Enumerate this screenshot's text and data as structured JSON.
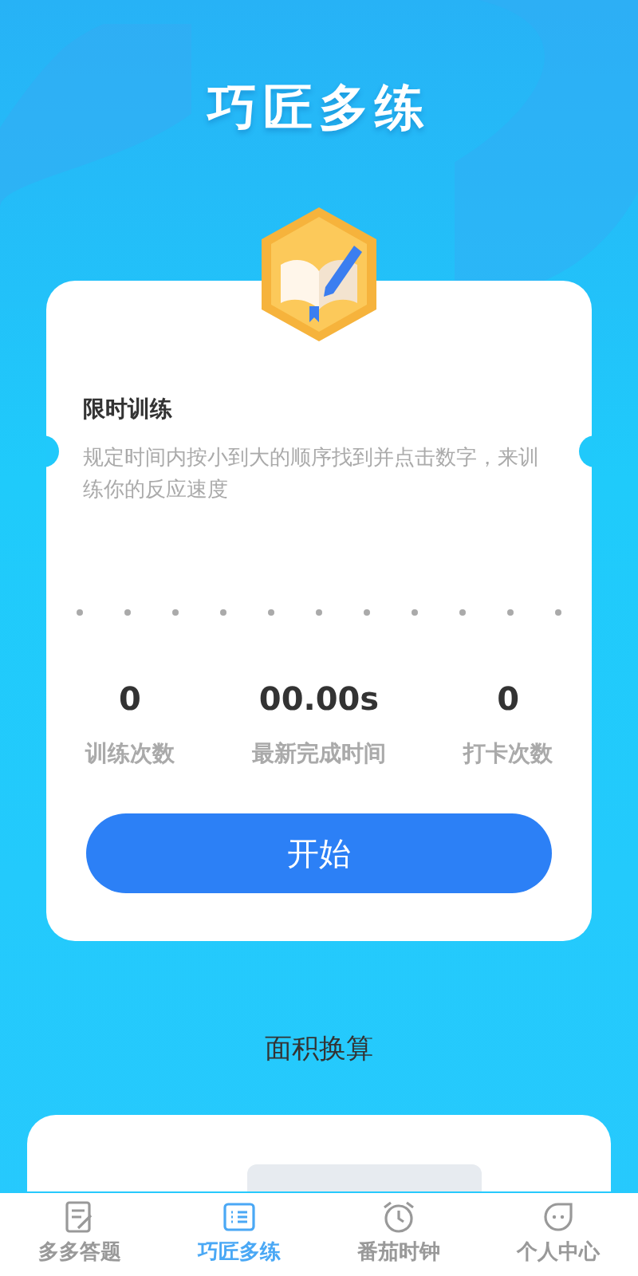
{
  "header": {
    "title": "巧匠多练"
  },
  "training_card": {
    "title": "限时训练",
    "description": "规定时间内按小到大的顺序找到并点击数字，来训练你的反应速度",
    "stats": [
      {
        "value": "0",
        "label": "训练次数"
      },
      {
        "value": "00.00s",
        "label": "最新完成时间"
      },
      {
        "value": "0",
        "label": "打卡次数"
      }
    ],
    "start_button": "开始"
  },
  "conversion": {
    "title": "面积换算"
  },
  "tab_bar": [
    {
      "label": "多多答题",
      "kind": "note",
      "selected": false
    },
    {
      "label": "巧匠多练",
      "kind": "list",
      "selected": true
    },
    {
      "label": "番茄时钟",
      "kind": "clock",
      "selected": false
    },
    {
      "label": "个人中心",
      "kind": "face",
      "selected": false
    }
  ]
}
